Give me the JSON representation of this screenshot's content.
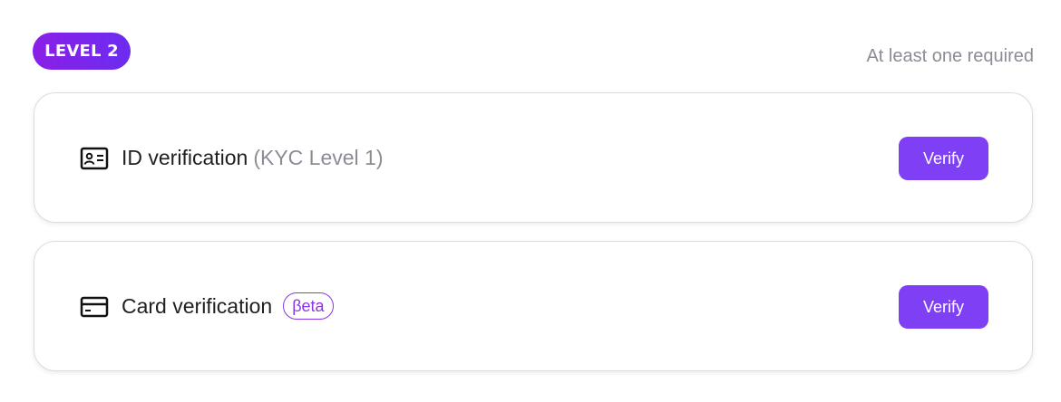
{
  "section": {
    "level_badge": "LEVEL 2",
    "requirement_note": "At least one required"
  },
  "verifications": [
    {
      "icon": "id-card-icon",
      "title": "ID verification",
      "subtitle": "(KYC Level 1)",
      "button_label": "Verify"
    },
    {
      "icon": "credit-card-icon",
      "title": "Card verification",
      "badge": "βeta",
      "button_label": "Verify"
    }
  ],
  "colors": {
    "accent": "#7f3ff5",
    "badge_gradient_start": "#8a1fe6",
    "badge_gradient_end": "#6c2cf0",
    "muted_text": "#8a8d96"
  }
}
